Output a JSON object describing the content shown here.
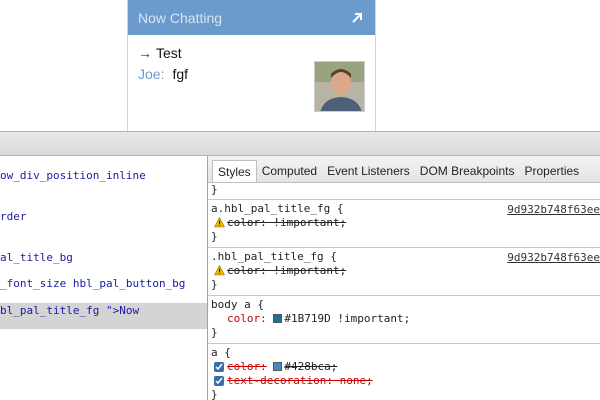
{
  "chat": {
    "title": "Now Chatting",
    "popout_glyph": "↗",
    "line1_arrow": "→",
    "line1_text": "Test",
    "sender": "Joe:",
    "message": "fgf"
  },
  "elements": {
    "lines": [
      "ow_div_position_inline",
      "rder",
      "al_title_bg",
      "_font_size hbl_pal_button_bg",
      "bl_pal_title_fg \">Now"
    ],
    "last_close": ">Now"
  },
  "styles": {
    "tabs": [
      "Styles",
      "Computed",
      "Event Listeners",
      "DOM Breakpoints",
      "Properties"
    ],
    "top_brace": "}",
    "rules": [
      {
        "selector": "a.hbl_pal_title_fg {",
        "source": "9d932b748f63ee",
        "props": [
          {
            "text": "color: !important;"
          }
        ],
        "close": "}"
      },
      {
        "selector": ".hbl_pal_title_fg {",
        "source": "9d932b748f63ee",
        "props": [
          {
            "text": "color: !important;"
          }
        ],
        "close": "}"
      },
      {
        "selector": "body a {",
        "props": [
          {
            "name": "color:",
            "value": "#1B719D !important;"
          }
        ],
        "close": "}"
      },
      {
        "selector": "a {",
        "props": [
          {
            "text_name": "color:",
            "text_value": "#428bca;"
          },
          {
            "text": "text-decoration: none;"
          }
        ],
        "close": "}"
      }
    ]
  },
  "colors": {
    "header_bg": "#6b9bcc",
    "swatch_1b719d": "#1B719D",
    "swatch_428bca": "#428bca"
  }
}
